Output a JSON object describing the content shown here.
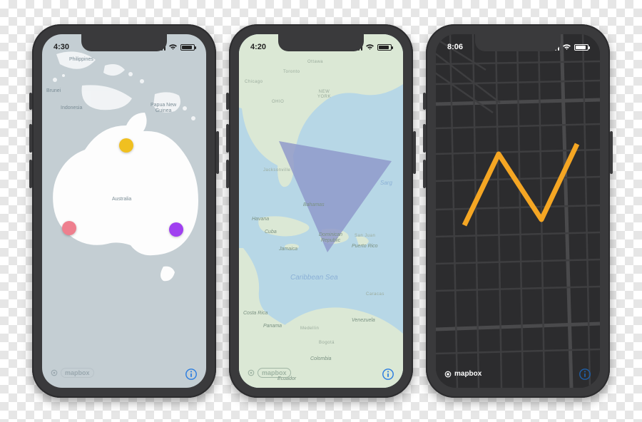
{
  "phone1": {
    "statusbar": {
      "time": "4:30"
    },
    "map": {
      "labels": {
        "philippines": "Philippines",
        "brunei": "Brunei",
        "indonesia": "Indonesia",
        "png": "Papua New\nGuinea",
        "australia": "Australia"
      },
      "markers": [
        {
          "name": "north-marker",
          "color": "yellow"
        },
        {
          "name": "west-marker",
          "color": "pink"
        },
        {
          "name": "east-marker",
          "color": "purple"
        }
      ],
      "attribution": "mapbox"
    },
    "info_label": "info"
  },
  "phone2": {
    "statusbar": {
      "time": "4:20"
    },
    "map": {
      "labels": {
        "ottawa": "Ottawa",
        "toronto": "Toronto",
        "chicago": "Chicago",
        "jacksonville": "Jacksonville",
        "ohio": "OHIO",
        "newyork": "NEW\nYORK",
        "havana": "Havana",
        "cuba": "Cuba",
        "bahamas": "Bahamas",
        "jamaica": "Jamaica",
        "dr": "Dominican\nRepublic",
        "pr": "Puerto Rico",
        "sarg": "Sarg",
        "caribbean": "Caribbean Sea",
        "costarica": "Costa Rica",
        "panama": "Panama",
        "medellin": "Medellin",
        "bogota": "Bogotá",
        "colombia": "Colombia",
        "venezuela": "Venezuela",
        "ecuador": "Ecuador",
        "sanjuan": "San Juan",
        "caracas": "Caracas"
      },
      "attribution": "mapbox"
    },
    "info_label": "info"
  },
  "phone3": {
    "statusbar": {
      "time": "8:06"
    },
    "map": {
      "attribution": "mapbox"
    },
    "info_label": "info"
  }
}
